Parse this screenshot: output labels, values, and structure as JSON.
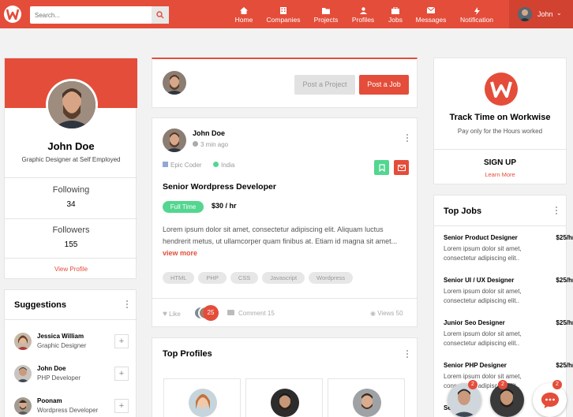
{
  "header": {
    "search_placeholder": "Search...",
    "nav": [
      {
        "label": "Home",
        "icon": "home-icon"
      },
      {
        "label": "Companies",
        "icon": "building-icon"
      },
      {
        "label": "Projects",
        "icon": "folder-icon"
      },
      {
        "label": "Profiles",
        "icon": "user-icon"
      },
      {
        "label": "Jobs",
        "icon": "briefcase-icon"
      },
      {
        "label": "Messages",
        "icon": "envelope-icon"
      },
      {
        "label": "Notification",
        "icon": "bolt-icon"
      }
    ],
    "user_name": "John"
  },
  "profile": {
    "name": "John Doe",
    "title": "Graphic Designer at Self Employed",
    "following_label": "Following",
    "following_count": "34",
    "followers_label": "Followers",
    "followers_count": "155",
    "view_profile": "View Profile"
  },
  "suggestions": {
    "title": "Suggestions",
    "items": [
      {
        "name": "Jessica William",
        "role": "Graphic Designer"
      },
      {
        "name": "John Doe",
        "role": "PHP Developer"
      },
      {
        "name": "Poonam",
        "role": "Wordpress Developer"
      }
    ]
  },
  "composer": {
    "post_project": "Post a Project",
    "post_job": "Post a Job"
  },
  "post": {
    "author": "John Doe",
    "time": "3 min ago",
    "company": "Epic Coder",
    "location": "India",
    "title": "Senior Wordpress Developer",
    "type": "Full Time",
    "rate": "$30 / hr",
    "body": "Lorem ipsum dolor sit amet, consectetur adipiscing elit. Aliquam luctus hendrerit metus, ut ullamcorper quam finibus at. Etiam id magna sit amet...",
    "view_more": "view more",
    "tags": [
      "HTML",
      "PHP",
      "CSS",
      "Javascript",
      "Wordpress"
    ],
    "like_label": "Like",
    "like_count": "25",
    "comment_label": "Comment 15",
    "views_label": "Views 50"
  },
  "top_profiles": {
    "title": "Top Profiles"
  },
  "workwise": {
    "title": "Track Time on Workwise",
    "subtitle": "Pay only for the Hours worked",
    "signup": "SIGN UP",
    "learn_more": "Learn More"
  },
  "top_jobs": {
    "title": "Top Jobs",
    "items": [
      {
        "title": "Senior Product Designer",
        "rate": "$25/hr",
        "desc": "Lorem ipsum dolor sit amet, consectetur adipiscing elit.."
      },
      {
        "title": "Senior UI / UX Designer",
        "rate": "$25/hr",
        "desc": "Lorem ipsum dolor sit amet, consectetur adipiscing elit.."
      },
      {
        "title": "Junior Seo Designer",
        "rate": "$25/hr",
        "desc": "Lorem ipsum dolor sit amet, consectetur adipiscing elit.."
      },
      {
        "title": "Senior PHP Designer",
        "rate": "$25/hr",
        "desc": "Lorem ipsum dolor sit amet, consectetur adipiscing elit.."
      },
      {
        "title": "Se",
        "rate": "",
        "desc": ""
      }
    ]
  },
  "chat": {
    "badge_1": "2",
    "badge_2": "2",
    "badge_3": "2"
  },
  "colors": {
    "brand": "#e44d3a",
    "fulltime": "#53d690",
    "bookmark": "#53d690"
  }
}
